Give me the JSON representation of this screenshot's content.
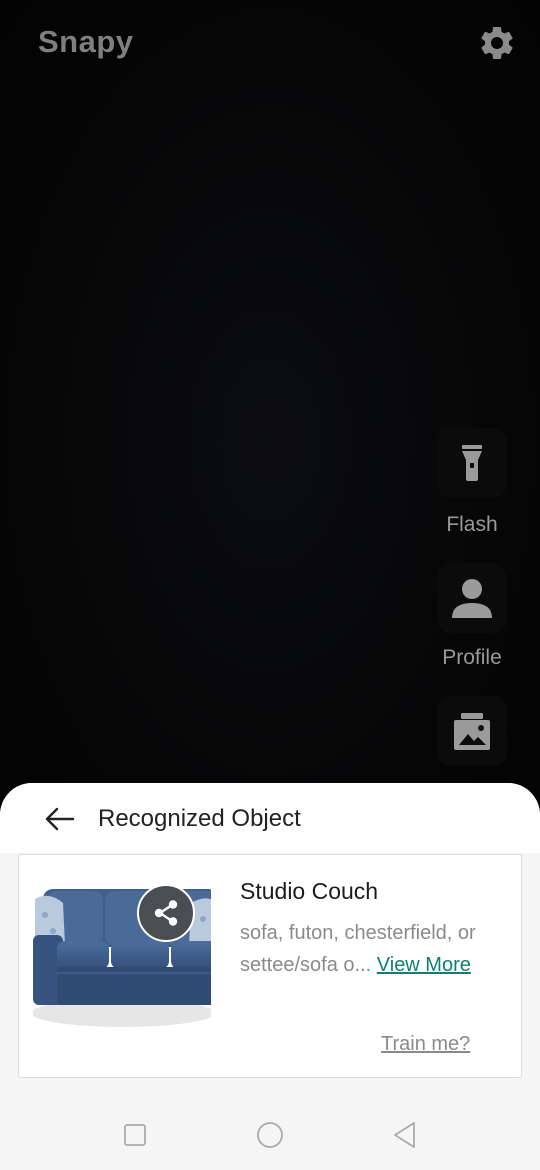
{
  "app": {
    "title": "Snapy"
  },
  "side_actions": {
    "flash": {
      "label": "Flash",
      "icon": "flashlight-icon"
    },
    "profile": {
      "label": "Profile",
      "icon": "person-icon"
    },
    "gallery": {
      "icon": "gallery-icon"
    }
  },
  "sheet": {
    "title": "Recognized Object",
    "result": {
      "name": "Studio Couch",
      "description": "sofa, futon, chesterfield, or settee/sofa o...",
      "view_more_label": "View More",
      "train_label": "Train me?"
    }
  },
  "colors": {
    "accent_link": "#0f7f74",
    "couch_blue": "#3f5f8c",
    "sheet_background": "#f5f5f5"
  },
  "icons": {
    "settings": "gear-icon",
    "back": "arrow-left-icon",
    "share": "share-icon",
    "nav_recents": "square-icon",
    "nav_home": "circle-icon",
    "nav_back": "triangle-back-icon"
  }
}
